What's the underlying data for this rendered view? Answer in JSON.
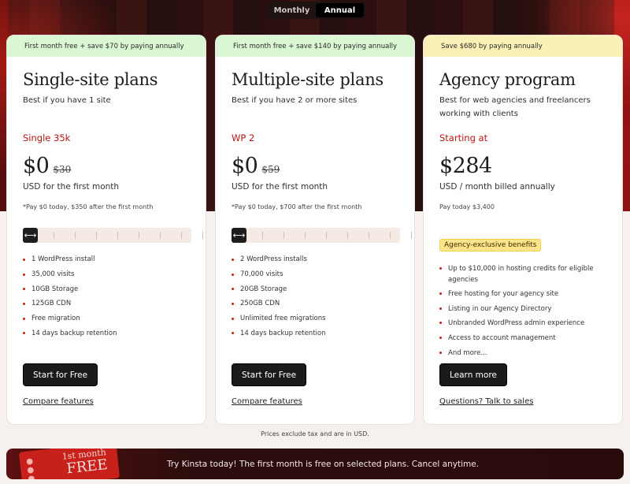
{
  "toggle": {
    "monthly": "Monthly",
    "annual": "Annual",
    "selected": "Annual"
  },
  "colors": {
    "accent": "#b81613",
    "promo_green": "#d9f7d2",
    "promo_yellow": "#fbf1b7",
    "badge": "#fde38a"
  },
  "cards": [
    {
      "promo": "First month free + save $70 by paying annually",
      "title": "Single-site plans",
      "subtitle": "Best if you have 1 site",
      "tier": "Single 35k",
      "price": "$0",
      "old_price": "$30",
      "price_unit": "USD for the first month",
      "pay_note": "*Pay $0 today, $350 after the first month",
      "slider_position": 0,
      "features": [
        "1 WordPress install",
        "35,000 visits",
        "10GB Storage",
        "125GB CDN",
        "Free migration",
        "14 days backup retention"
      ],
      "cta": "Start for Free",
      "link": "Compare features"
    },
    {
      "promo": "First month free + save $140 by paying annually",
      "title": "Multiple-site plans",
      "subtitle": "Best if you have 2 or more sites",
      "tier": "WP 2",
      "price": "$0",
      "old_price": "$59",
      "price_unit": "USD for the first month",
      "pay_note": "*Pay $0 today, $700 after the first month",
      "slider_position": 0,
      "features": [
        "2 WordPress installs",
        "70,000 visits",
        "20GB Storage",
        "250GB CDN",
        "Unlimited free migrations",
        "14 days backup retention"
      ],
      "cta": "Start for Free",
      "link": "Compare features"
    },
    {
      "promo": "Save $680 by paying annually",
      "title": "Agency program",
      "subtitle": "Best for web agencies and freelancers working with clients",
      "tier": "Starting at",
      "price": "$284",
      "price_unit": "USD / month billed annually",
      "pay_note": "Pay today $3,400",
      "badge": "Agency-exclusive benefits",
      "features": [
        "Up to $10,000 in hosting credits for eligible agencies",
        "Free hosting for your agency site",
        "Listing in our Agency Directory",
        "Unbranded WordPress admin experience",
        "Access to account management",
        "And more..."
      ],
      "cta": "Learn more",
      "link": "Questions? Talk to sales"
    }
  ],
  "tax_note": "Prices exclude tax and are in USD.",
  "banner": {
    "ticket_top": "1st month",
    "ticket_main": "FREE",
    "text": "Try Kinsta today! The first month is free on selected plans. Cancel anytime."
  }
}
